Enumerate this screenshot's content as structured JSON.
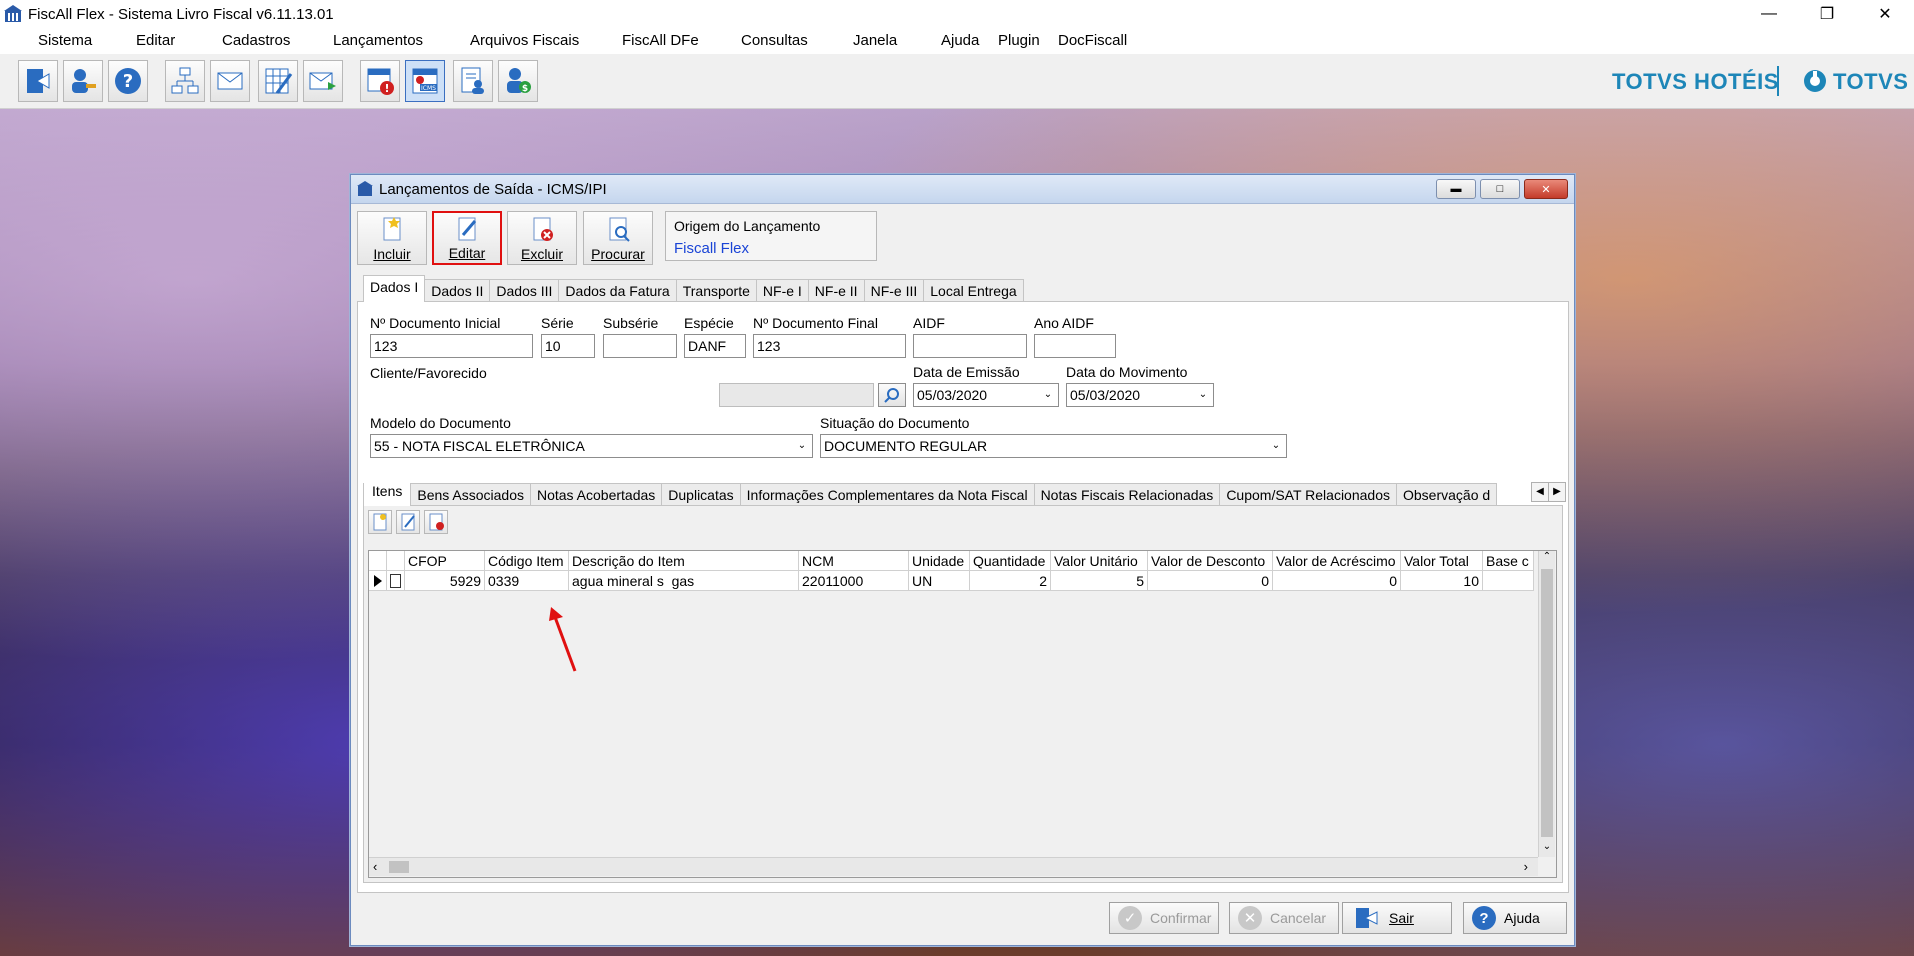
{
  "window": {
    "title": "FiscAll Flex - Sistema Livro Fiscal v6.11.13.01"
  },
  "menu": [
    "Sistema",
    "Editar",
    "Cadastros",
    "Lançamentos",
    "Arquivos Fiscais",
    "FiscAll DFe",
    "Consultas",
    "Janela",
    "Ajuda",
    "Plugin",
    "DocFiscall"
  ],
  "brand": {
    "left": "TOTVS HOTÉIS",
    "right": "TOTVS",
    "color": "#1d86b8"
  },
  "dialog": {
    "title": "Lançamentos de Saída - ICMS/IPI",
    "actions": {
      "incluir": "Incluir",
      "editar": "Editar",
      "excluir": "Excluir",
      "procurar": "Procurar"
    },
    "origem": {
      "label": "Origem do Lançamento",
      "value": "Fiscall Flex"
    },
    "tabs": [
      "Dados I",
      "Dados II",
      "Dados III",
      "Dados da Fatura",
      "Transporte",
      "NF-e I",
      "NF-e II",
      "NF-e III",
      "Local Entrega"
    ],
    "fields": {
      "doc_inicial": {
        "label": "Nº Documento Inicial",
        "value": "123"
      },
      "serie": {
        "label": "Série",
        "value": "10"
      },
      "subserie": {
        "label": "Subsérie",
        "value": ""
      },
      "especie": {
        "label": "Espécie",
        "value": "DANF"
      },
      "doc_final": {
        "label": "Nº Documento Final",
        "value": "123"
      },
      "aidf": {
        "label": "AIDF",
        "value": ""
      },
      "ano_aidf": {
        "label": "Ano AIDF",
        "value": ""
      },
      "cliente": {
        "label": "Cliente/Favorecido",
        "value": ""
      },
      "data_emissao": {
        "label": "Data de Emissão",
        "value": "05/03/2020"
      },
      "data_movimento": {
        "label": "Data do Movimento",
        "value": "05/03/2020"
      },
      "modelo": {
        "label": "Modelo do Documento",
        "value": "55 - NOTA FISCAL ELETRÔNICA"
      },
      "situacao": {
        "label": "Situação do Documento",
        "value": "DOCUMENTO REGULAR"
      }
    },
    "subtabs": [
      "Itens",
      "Bens Associados",
      "Notas Acobertadas",
      "Duplicatas",
      "Informações Complementares da Nota Fiscal",
      "Notas Fiscais Relacionadas",
      "Cupom/SAT Relacionados",
      "Observação d"
    ],
    "grid": {
      "headers": [
        "CFOP",
        "Código Item",
        "Descrição do Item",
        "NCM",
        "Unidade",
        "Quantidade",
        "Valor Unitário",
        "Valor de Desconto",
        "Valor de Acréscimo",
        "Valor Total",
        "Base c"
      ],
      "rows": [
        [
          "5929",
          "0339",
          "agua mineral s  gas",
          "22011000",
          "UN",
          "2",
          "5",
          "0",
          "0",
          "10",
          ""
        ]
      ]
    },
    "footer": {
      "confirmar": "Confirmar",
      "cancelar": "Cancelar",
      "sair": "Sair",
      "ajuda": "Ajuda"
    }
  }
}
